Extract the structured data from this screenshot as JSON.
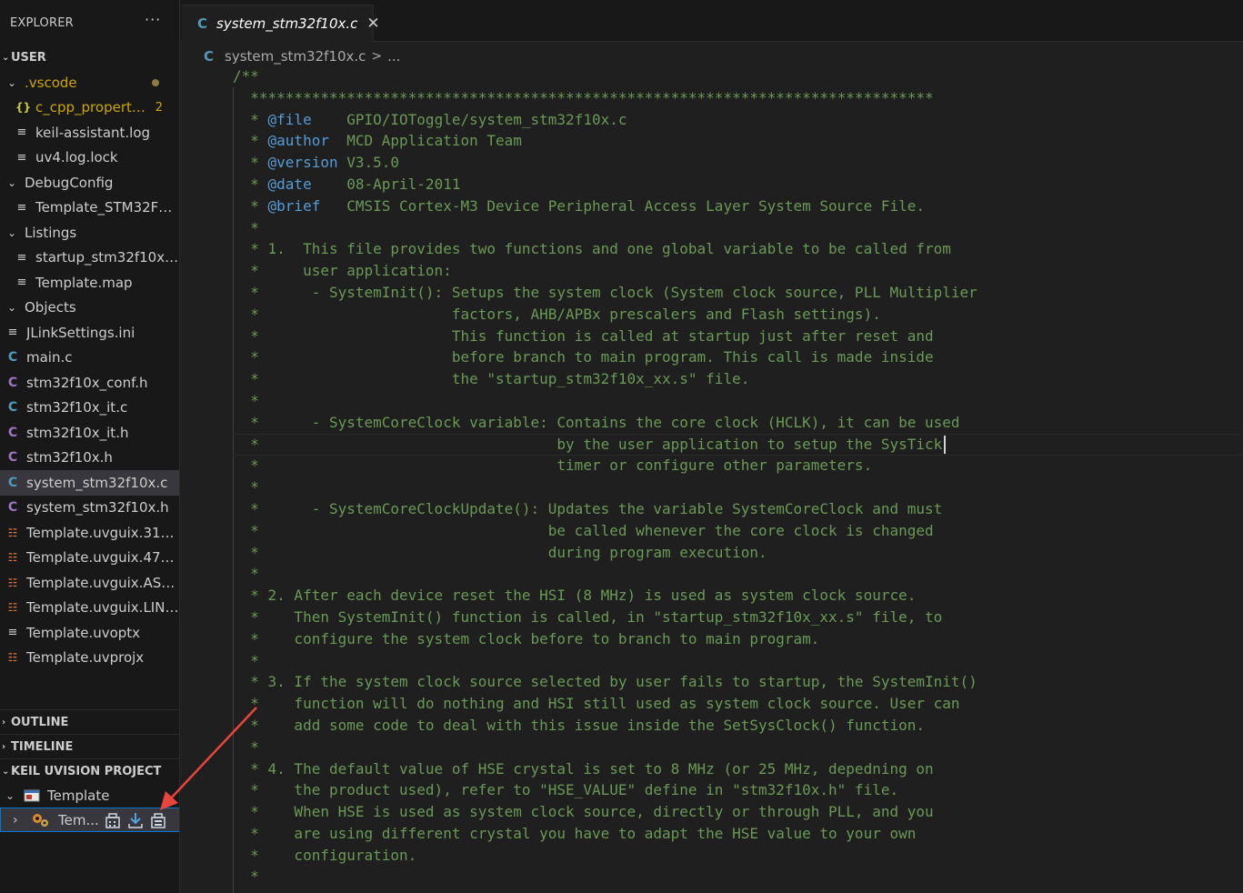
{
  "explorer": {
    "title": "EXPLORER",
    "more": "···",
    "section": "USER",
    "items": [
      {
        "label": ".vscode",
        "kind": "folder",
        "depth": 0,
        "open": true,
        "color": "#cca700",
        "dot": true
      },
      {
        "label": "c_cpp_properti...",
        "kind": "json",
        "depth": 1,
        "badge": "2",
        "color": "#cca700"
      },
      {
        "label": "keil-assistant.log",
        "kind": "lines",
        "depth": 1
      },
      {
        "label": "uv4.log.lock",
        "kind": "lines",
        "depth": 1
      },
      {
        "label": "DebugConfig",
        "kind": "folder",
        "depth": 0,
        "open": true
      },
      {
        "label": "Template_STM32F10...",
        "kind": "lines",
        "depth": 1
      },
      {
        "label": "Listings",
        "kind": "folder",
        "depth": 0,
        "open": true
      },
      {
        "label": "startup_stm32f10x_...",
        "kind": "lines",
        "depth": 1
      },
      {
        "label": "Template.map",
        "kind": "lines",
        "depth": 1
      },
      {
        "label": "Objects",
        "kind": "folder",
        "depth": 0,
        "open": true
      },
      {
        "label": "JLinkSettings.ini",
        "kind": "lines",
        "depth": 0
      },
      {
        "label": "main.c",
        "kind": "c",
        "depth": 0
      },
      {
        "label": "stm32f10x_conf.h",
        "kind": "h",
        "depth": 0
      },
      {
        "label": "stm32f10x_it.c",
        "kind": "c",
        "depth": 0
      },
      {
        "label": "stm32f10x_it.h",
        "kind": "h",
        "depth": 0
      },
      {
        "label": "stm32f10x.h",
        "kind": "h",
        "depth": 0
      },
      {
        "label": "system_stm32f10x.c",
        "kind": "c",
        "depth": 0,
        "selected": true
      },
      {
        "label": "system_stm32f10x.h",
        "kind": "h",
        "depth": 0
      },
      {
        "label": "Template.uvguix.31990",
        "kind": "rss",
        "depth": 0
      },
      {
        "label": "Template.uvguix.47392",
        "kind": "rss",
        "depth": 0
      },
      {
        "label": "Template.uvguix.ASUS",
        "kind": "rss",
        "depth": 0
      },
      {
        "label": "Template.uvguix.LING...",
        "kind": "rss",
        "depth": 0
      },
      {
        "label": "Template.uvoptx",
        "kind": "lines",
        "depth": 0
      },
      {
        "label": "Template.uvprojx",
        "kind": "rss",
        "depth": 0
      }
    ],
    "outline": "OUTLINE",
    "timeline": "TIMELINE",
    "keil": "KEIL UVISION PROJECT",
    "project": "Template",
    "target": "Tem..."
  },
  "editor": {
    "tab_icon": "C",
    "tab_label": "system_stm32f10x.c",
    "tab_close": "✕",
    "breadcrumb_file": "system_stm32f10x.c",
    "breadcrumb_sep": ">",
    "breadcrumb_rest": "...",
    "cursor_line": 17,
    "lines": [
      {
        "t": "/**"
      },
      {
        "t": "  ******************************************************************************"
      },
      {
        "pre": "  * ",
        "tag": "@file",
        "t": "    GPIO/IOToggle/system_stm32f10x.c"
      },
      {
        "pre": "  * ",
        "tag": "@author",
        "t": "  MCD Application Team"
      },
      {
        "pre": "  * ",
        "tag": "@version",
        "t": " V3.5.0"
      },
      {
        "pre": "  * ",
        "tag": "@date",
        "t": "    08-April-2011"
      },
      {
        "pre": "  * ",
        "tag": "@brief",
        "t": "   CMSIS Cortex-M3 Device Peripheral Access Layer System Source File."
      },
      {
        "t": "  *"
      },
      {
        "t": "  * 1.  This file provides two functions and one global variable to be called from"
      },
      {
        "t": "  *     user application:"
      },
      {
        "t": "  *      - SystemInit(): Setups the system clock (System clock source, PLL Multiplier"
      },
      {
        "t": "  *                      factors, AHB/APBx prescalers and Flash settings)."
      },
      {
        "t": "  *                      This function is called at startup just after reset and"
      },
      {
        "t": "  *                      before branch to main program. This call is made inside"
      },
      {
        "t": "  *                      the \"startup_stm32f10x_xx.s\" file."
      },
      {
        "t": "  *"
      },
      {
        "t": "  *      - SystemCoreClock variable: Contains the core clock (HCLK), it can be used"
      },
      {
        "t": "  *                                  by the user application to setup the SysTick"
      },
      {
        "t": "  *                                  timer or configure other parameters."
      },
      {
        "t": "  *"
      },
      {
        "t": "  *      - SystemCoreClockUpdate(): Updates the variable SystemCoreClock and must"
      },
      {
        "t": "  *                                 be called whenever the core clock is changed"
      },
      {
        "t": "  *                                 during program execution."
      },
      {
        "t": "  *"
      },
      {
        "t": "  * 2. After each device reset the HSI (8 MHz) is used as system clock source."
      },
      {
        "t": "  *    Then SystemInit() function is called, in \"startup_stm32f10x_xx.s\" file, to"
      },
      {
        "t": "  *    configure the system clock before to branch to main program."
      },
      {
        "t": "  *"
      },
      {
        "t": "  * 3. If the system clock source selected by user fails to startup, the SystemInit()"
      },
      {
        "t": "  *    function will do nothing and HSI still used as system clock source. User can"
      },
      {
        "t": "  *    add some code to deal with this issue inside the SetSysClock() function."
      },
      {
        "t": "  *"
      },
      {
        "t": "  * 4. The default value of HSE crystal is set to 8 MHz (or 25 MHz, depedning on"
      },
      {
        "t": "  *    the product used), refer to \"HSE_VALUE\" define in \"stm32f10x.h\" file."
      },
      {
        "t": "  *    When HSE is used as system clock source, directly or through PLL, and you"
      },
      {
        "t": "  *    are using different crystal you have to adapt the HSE value to your own"
      },
      {
        "t": "  *    configuration."
      },
      {
        "t": "  *"
      }
    ]
  },
  "colors": {
    "comment": "#6a9955",
    "doc_tag": "#569cd6",
    "arrow": "#e8453c"
  }
}
